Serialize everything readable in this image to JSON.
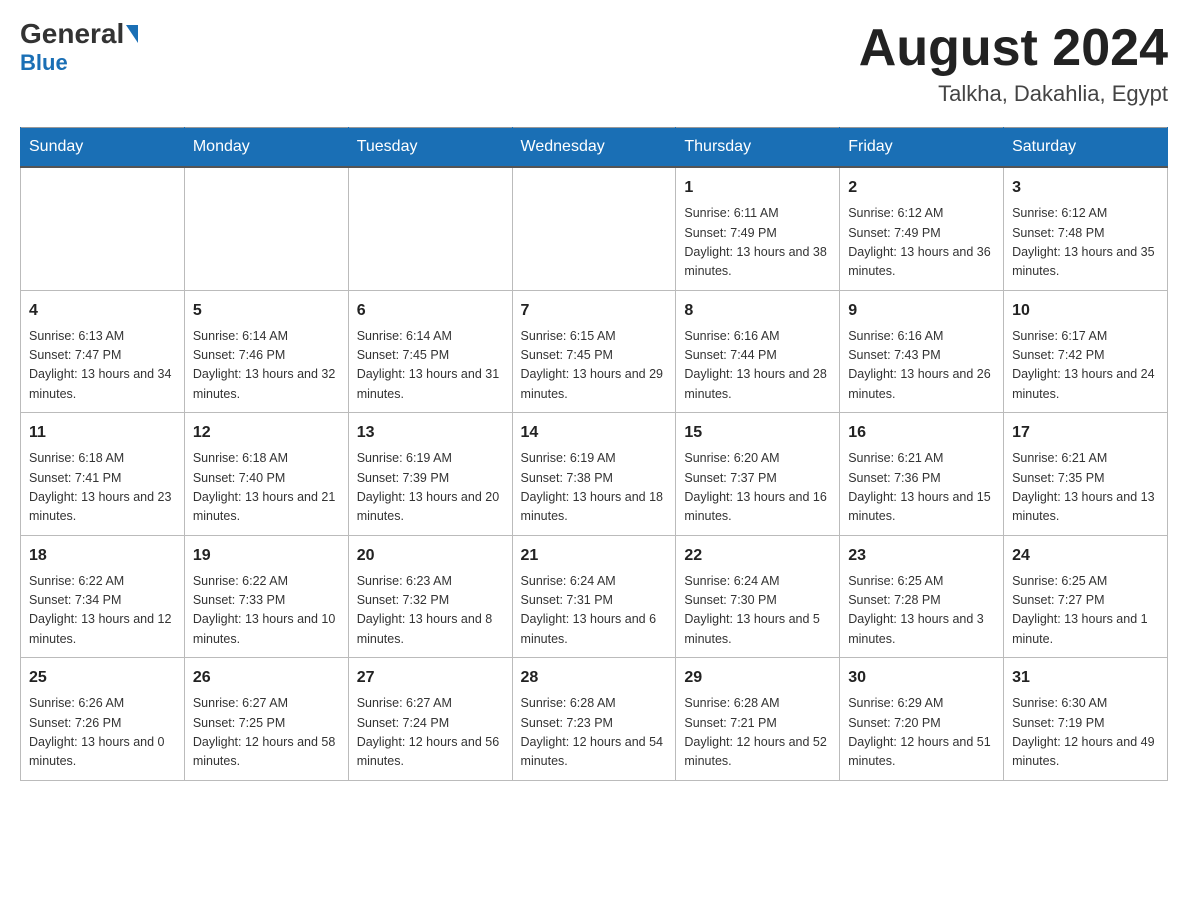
{
  "header": {
    "logo_general": "General",
    "logo_blue": "Blue",
    "month_year": "August 2024",
    "location": "Talkha, Dakahlia, Egypt"
  },
  "days_of_week": [
    "Sunday",
    "Monday",
    "Tuesday",
    "Wednesday",
    "Thursday",
    "Friday",
    "Saturday"
  ],
  "weeks": [
    [
      {
        "num": "",
        "info": ""
      },
      {
        "num": "",
        "info": ""
      },
      {
        "num": "",
        "info": ""
      },
      {
        "num": "",
        "info": ""
      },
      {
        "num": "1",
        "info": "Sunrise: 6:11 AM\nSunset: 7:49 PM\nDaylight: 13 hours and 38 minutes."
      },
      {
        "num": "2",
        "info": "Sunrise: 6:12 AM\nSunset: 7:49 PM\nDaylight: 13 hours and 36 minutes."
      },
      {
        "num": "3",
        "info": "Sunrise: 6:12 AM\nSunset: 7:48 PM\nDaylight: 13 hours and 35 minutes."
      }
    ],
    [
      {
        "num": "4",
        "info": "Sunrise: 6:13 AM\nSunset: 7:47 PM\nDaylight: 13 hours and 34 minutes."
      },
      {
        "num": "5",
        "info": "Sunrise: 6:14 AM\nSunset: 7:46 PM\nDaylight: 13 hours and 32 minutes."
      },
      {
        "num": "6",
        "info": "Sunrise: 6:14 AM\nSunset: 7:45 PM\nDaylight: 13 hours and 31 minutes."
      },
      {
        "num": "7",
        "info": "Sunrise: 6:15 AM\nSunset: 7:45 PM\nDaylight: 13 hours and 29 minutes."
      },
      {
        "num": "8",
        "info": "Sunrise: 6:16 AM\nSunset: 7:44 PM\nDaylight: 13 hours and 28 minutes."
      },
      {
        "num": "9",
        "info": "Sunrise: 6:16 AM\nSunset: 7:43 PM\nDaylight: 13 hours and 26 minutes."
      },
      {
        "num": "10",
        "info": "Sunrise: 6:17 AM\nSunset: 7:42 PM\nDaylight: 13 hours and 24 minutes."
      }
    ],
    [
      {
        "num": "11",
        "info": "Sunrise: 6:18 AM\nSunset: 7:41 PM\nDaylight: 13 hours and 23 minutes."
      },
      {
        "num": "12",
        "info": "Sunrise: 6:18 AM\nSunset: 7:40 PM\nDaylight: 13 hours and 21 minutes."
      },
      {
        "num": "13",
        "info": "Sunrise: 6:19 AM\nSunset: 7:39 PM\nDaylight: 13 hours and 20 minutes."
      },
      {
        "num": "14",
        "info": "Sunrise: 6:19 AM\nSunset: 7:38 PM\nDaylight: 13 hours and 18 minutes."
      },
      {
        "num": "15",
        "info": "Sunrise: 6:20 AM\nSunset: 7:37 PM\nDaylight: 13 hours and 16 minutes."
      },
      {
        "num": "16",
        "info": "Sunrise: 6:21 AM\nSunset: 7:36 PM\nDaylight: 13 hours and 15 minutes."
      },
      {
        "num": "17",
        "info": "Sunrise: 6:21 AM\nSunset: 7:35 PM\nDaylight: 13 hours and 13 minutes."
      }
    ],
    [
      {
        "num": "18",
        "info": "Sunrise: 6:22 AM\nSunset: 7:34 PM\nDaylight: 13 hours and 12 minutes."
      },
      {
        "num": "19",
        "info": "Sunrise: 6:22 AM\nSunset: 7:33 PM\nDaylight: 13 hours and 10 minutes."
      },
      {
        "num": "20",
        "info": "Sunrise: 6:23 AM\nSunset: 7:32 PM\nDaylight: 13 hours and 8 minutes."
      },
      {
        "num": "21",
        "info": "Sunrise: 6:24 AM\nSunset: 7:31 PM\nDaylight: 13 hours and 6 minutes."
      },
      {
        "num": "22",
        "info": "Sunrise: 6:24 AM\nSunset: 7:30 PM\nDaylight: 13 hours and 5 minutes."
      },
      {
        "num": "23",
        "info": "Sunrise: 6:25 AM\nSunset: 7:28 PM\nDaylight: 13 hours and 3 minutes."
      },
      {
        "num": "24",
        "info": "Sunrise: 6:25 AM\nSunset: 7:27 PM\nDaylight: 13 hours and 1 minute."
      }
    ],
    [
      {
        "num": "25",
        "info": "Sunrise: 6:26 AM\nSunset: 7:26 PM\nDaylight: 13 hours and 0 minutes."
      },
      {
        "num": "26",
        "info": "Sunrise: 6:27 AM\nSunset: 7:25 PM\nDaylight: 12 hours and 58 minutes."
      },
      {
        "num": "27",
        "info": "Sunrise: 6:27 AM\nSunset: 7:24 PM\nDaylight: 12 hours and 56 minutes."
      },
      {
        "num": "28",
        "info": "Sunrise: 6:28 AM\nSunset: 7:23 PM\nDaylight: 12 hours and 54 minutes."
      },
      {
        "num": "29",
        "info": "Sunrise: 6:28 AM\nSunset: 7:21 PM\nDaylight: 12 hours and 52 minutes."
      },
      {
        "num": "30",
        "info": "Sunrise: 6:29 AM\nSunset: 7:20 PM\nDaylight: 12 hours and 51 minutes."
      },
      {
        "num": "31",
        "info": "Sunrise: 6:30 AM\nSunset: 7:19 PM\nDaylight: 12 hours and 49 minutes."
      }
    ]
  ]
}
